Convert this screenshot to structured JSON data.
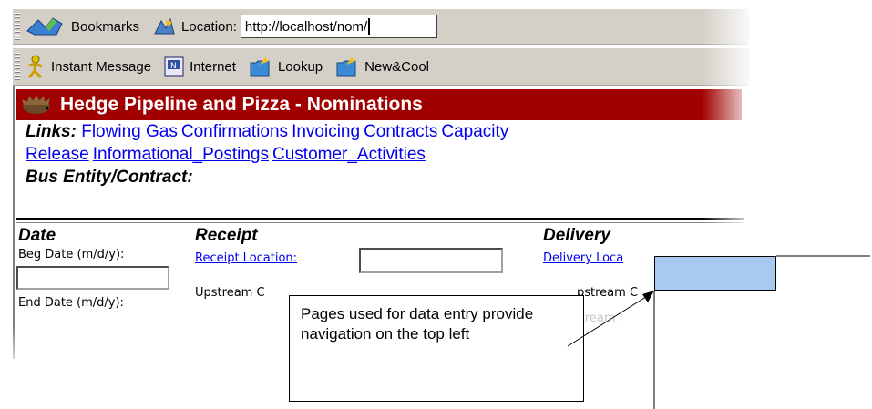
{
  "browser": {
    "location_toolbar": {
      "bookmarks_label": "Bookmarks",
      "location_label": "Location:",
      "url": "http://localhost/nom/"
    },
    "personal_toolbar": {
      "items": [
        "Instant Message",
        "Internet",
        "Lookup",
        "New&Cool"
      ]
    }
  },
  "page": {
    "title": "Hedge Pipeline and Pizza - Nominations",
    "links_label": "Links:",
    "links": [
      "Flowing Gas",
      "Confirmations",
      "Invoicing",
      "Contracts",
      "Capacity Release",
      "Informational_Postings",
      "Customer_Activities"
    ],
    "bus_entity_label": "Bus Entity/Contract:",
    "date": {
      "heading": "Date",
      "beg_label": "Beg Date (m/d/y):",
      "end_label": "End Date (m/d/y):"
    },
    "receipt": {
      "heading": "Receipt",
      "location_link": "Receipt Location:",
      "upstream_label": "Upstream C"
    },
    "delivery": {
      "heading": "Delivery",
      "location_link": "Delivery Loca",
      "upstream_label": "pstream C",
      "downstream_label": "stream I"
    }
  },
  "annotation": {
    "text": "Pages used for data entry provide navigation on the top left"
  },
  "colors": {
    "title_bar": "#a00000",
    "link": "#0000ee",
    "annotation_highlight": "#a6caf0",
    "toolbar": "#d4d0c8"
  }
}
